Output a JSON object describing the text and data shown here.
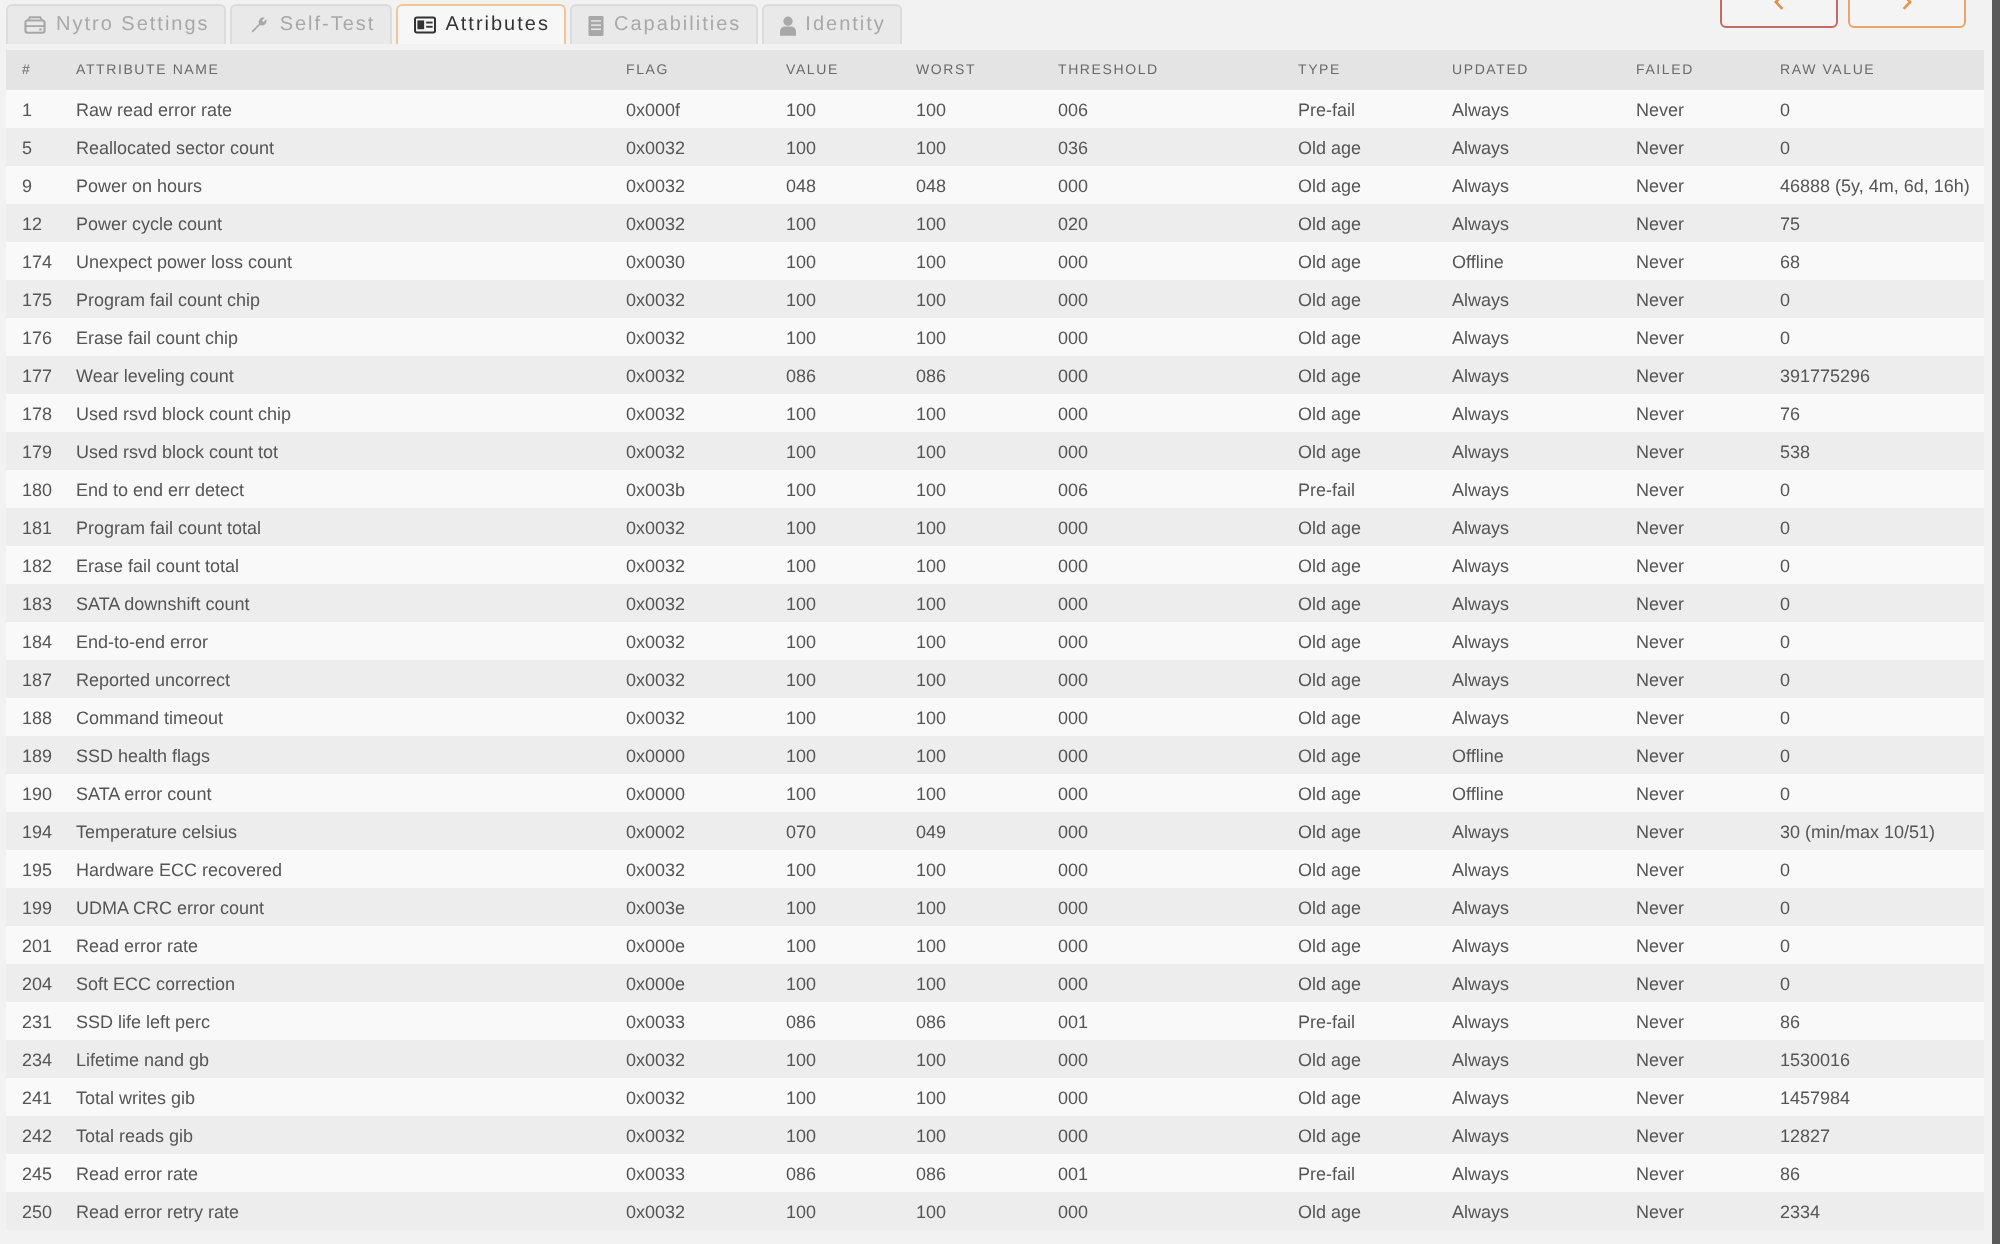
{
  "tabs": [
    {
      "label": "Nytro Settings",
      "selected": false
    },
    {
      "label": "Self-Test",
      "selected": false
    },
    {
      "label": "Attributes",
      "selected": true
    },
    {
      "label": "Capabilities",
      "selected": false
    },
    {
      "label": "Identity",
      "selected": false
    }
  ],
  "table": {
    "columns": [
      "#",
      "ATTRIBUTE NAME",
      "FLAG",
      "VALUE",
      "WORST",
      "THRESHOLD",
      "TYPE",
      "UPDATED",
      "FAILED",
      "RAW VALUE"
    ],
    "rows": [
      [
        "1",
        "Raw read error rate",
        "0x000f",
        "100",
        "100",
        "006",
        "Pre-fail",
        "Always",
        "Never",
        "0"
      ],
      [
        "5",
        "Reallocated sector count",
        "0x0032",
        "100",
        "100",
        "036",
        "Old age",
        "Always",
        "Never",
        "0"
      ],
      [
        "9",
        "Power on hours",
        "0x0032",
        "048",
        "048",
        "000",
        "Old age",
        "Always",
        "Never",
        "46888 (5y, 4m, 6d, 16h)"
      ],
      [
        "12",
        "Power cycle count",
        "0x0032",
        "100",
        "100",
        "020",
        "Old age",
        "Always",
        "Never",
        "75"
      ],
      [
        "174",
        "Unexpect power loss count",
        "0x0030",
        "100",
        "100",
        "000",
        "Old age",
        "Offline",
        "Never",
        "68"
      ],
      [
        "175",
        "Program fail count chip",
        "0x0032",
        "100",
        "100",
        "000",
        "Old age",
        "Always",
        "Never",
        "0"
      ],
      [
        "176",
        "Erase fail count chip",
        "0x0032",
        "100",
        "100",
        "000",
        "Old age",
        "Always",
        "Never",
        "0"
      ],
      [
        "177",
        "Wear leveling count",
        "0x0032",
        "086",
        "086",
        "000",
        "Old age",
        "Always",
        "Never",
        "391775296"
      ],
      [
        "178",
        "Used rsvd block count chip",
        "0x0032",
        "100",
        "100",
        "000",
        "Old age",
        "Always",
        "Never",
        "76"
      ],
      [
        "179",
        "Used rsvd block count tot",
        "0x0032",
        "100",
        "100",
        "000",
        "Old age",
        "Always",
        "Never",
        "538"
      ],
      [
        "180",
        "End to end err detect",
        "0x003b",
        "100",
        "100",
        "006",
        "Pre-fail",
        "Always",
        "Never",
        "0"
      ],
      [
        "181",
        "Program fail count total",
        "0x0032",
        "100",
        "100",
        "000",
        "Old age",
        "Always",
        "Never",
        "0"
      ],
      [
        "182",
        "Erase fail count total",
        "0x0032",
        "100",
        "100",
        "000",
        "Old age",
        "Always",
        "Never",
        "0"
      ],
      [
        "183",
        "SATA downshift count",
        "0x0032",
        "100",
        "100",
        "000",
        "Old age",
        "Always",
        "Never",
        "0"
      ],
      [
        "184",
        "End-to-end error",
        "0x0032",
        "100",
        "100",
        "000",
        "Old age",
        "Always",
        "Never",
        "0"
      ],
      [
        "187",
        "Reported uncorrect",
        "0x0032",
        "100",
        "100",
        "000",
        "Old age",
        "Always",
        "Never",
        "0"
      ],
      [
        "188",
        "Command timeout",
        "0x0032",
        "100",
        "100",
        "000",
        "Old age",
        "Always",
        "Never",
        "0"
      ],
      [
        "189",
        "SSD health flags",
        "0x0000",
        "100",
        "100",
        "000",
        "Old age",
        "Offline",
        "Never",
        "0"
      ],
      [
        "190",
        "SATA error count",
        "0x0000",
        "100",
        "100",
        "000",
        "Old age",
        "Offline",
        "Never",
        "0"
      ],
      [
        "194",
        "Temperature celsius",
        "0x0002",
        "070",
        "049",
        "000",
        "Old age",
        "Always",
        "Never",
        "30 (min/max 10/51)"
      ],
      [
        "195",
        "Hardware ECC recovered",
        "0x0032",
        "100",
        "100",
        "000",
        "Old age",
        "Always",
        "Never",
        "0"
      ],
      [
        "199",
        "UDMA CRC error count",
        "0x003e",
        "100",
        "100",
        "000",
        "Old age",
        "Always",
        "Never",
        "0"
      ],
      [
        "201",
        "Read error rate",
        "0x000e",
        "100",
        "100",
        "000",
        "Old age",
        "Always",
        "Never",
        "0"
      ],
      [
        "204",
        "Soft ECC correction",
        "0x000e",
        "100",
        "100",
        "000",
        "Old age",
        "Always",
        "Never",
        "0"
      ],
      [
        "231",
        "SSD life left perc",
        "0x0033",
        "086",
        "086",
        "001",
        "Pre-fail",
        "Always",
        "Never",
        "86"
      ],
      [
        "234",
        "Lifetime nand gb",
        "0x0032",
        "100",
        "100",
        "000",
        "Old age",
        "Always",
        "Never",
        "1530016"
      ],
      [
        "241",
        "Total writes gib",
        "0x0032",
        "100",
        "100",
        "000",
        "Old age",
        "Always",
        "Never",
        "1457984"
      ],
      [
        "242",
        "Total reads gib",
        "0x0032",
        "100",
        "100",
        "000",
        "Old age",
        "Always",
        "Never",
        "12827"
      ],
      [
        "245",
        "Read error rate",
        "0x0033",
        "086",
        "086",
        "001",
        "Pre-fail",
        "Always",
        "Never",
        "86"
      ],
      [
        "250",
        "Read error retry rate",
        "0x0032",
        "100",
        "100",
        "000",
        "Old age",
        "Always",
        "Never",
        "2334"
      ]
    ]
  }
}
